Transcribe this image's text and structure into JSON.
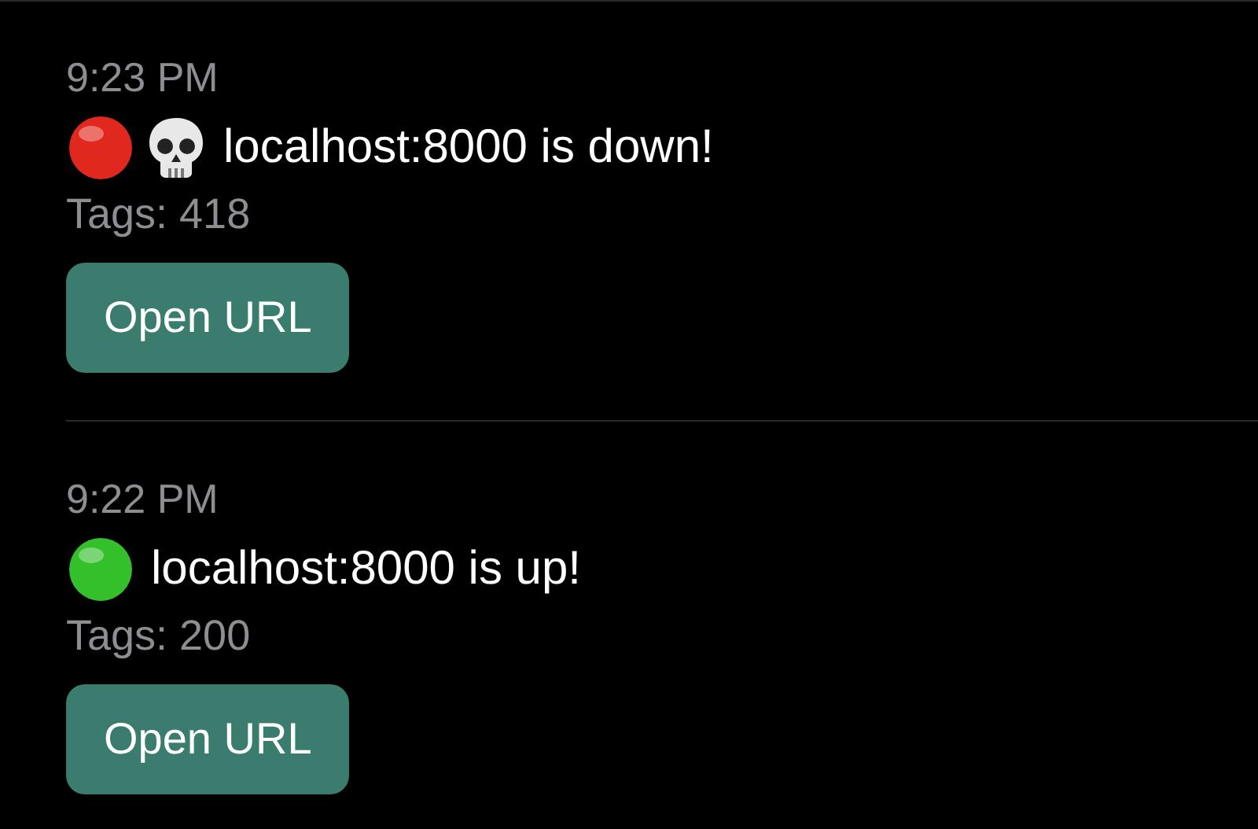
{
  "messages": [
    {
      "time": "9:23 PM",
      "kind": "down",
      "color": "#e0281e",
      "text": "localhost:8000 is down!",
      "tags": "Tags: 418",
      "button": "Open URL"
    },
    {
      "time": "9:22 PM",
      "kind": "up",
      "color": "#34c02a",
      "text": "localhost:8000 is up!",
      "tags": "Tags: 200",
      "button": "Open URL"
    }
  ]
}
